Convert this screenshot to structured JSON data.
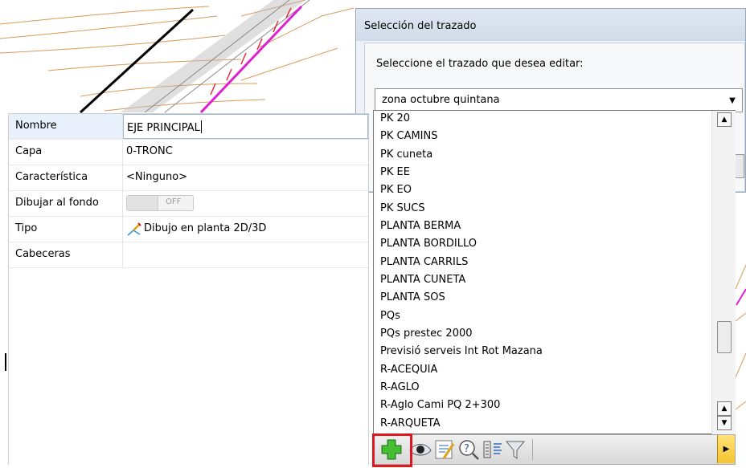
{
  "properties": {
    "rows": [
      {
        "label": "Nombre",
        "value": "EJE PRINCIPAL"
      },
      {
        "label": "Capa",
        "value": "0-TRONC"
      },
      {
        "label": "Característica",
        "value": "<Ninguno>"
      },
      {
        "label": "Dibujar al fondo",
        "value": "OFF"
      },
      {
        "label": "Tipo",
        "value": "Dibujo en planta 2D/3D"
      },
      {
        "label": "Cabeceras",
        "value": ""
      }
    ]
  },
  "dialog": {
    "title": "Selección del trazado",
    "prompt": "Seleccione el trazado que desea editar:",
    "selected": "zona octubre quintana"
  },
  "list": {
    "items": [
      "PK 20",
      "PK CAMINS",
      "PK cuneta",
      "PK EE",
      "PK EO",
      "PK SUCS",
      "PLANTA  BERMA",
      "PLANTA BORDILLO",
      "PLANTA CARRILS",
      "PLANTA CUNETA",
      "PLANTA SOS",
      "PQs",
      "PQs prestec 2000",
      "Previsió serveis Int Rot Mazana",
      "R-ACEQUIA",
      "R-AGLO",
      "R-Aglo Cami PQ 2+300",
      "R-ARQUETA"
    ]
  },
  "toolbar": {
    "buttons": [
      "add-icon",
      "eye-icon",
      "edit-icon",
      "help-icon",
      "properties-icon",
      "filter-icon",
      "more-icon"
    ]
  },
  "colors": {
    "highlight_border": "#e0161d",
    "alignment_line": "#e020d0",
    "add_icon": "#3aa92a",
    "contour_line": "#d99a5a"
  }
}
